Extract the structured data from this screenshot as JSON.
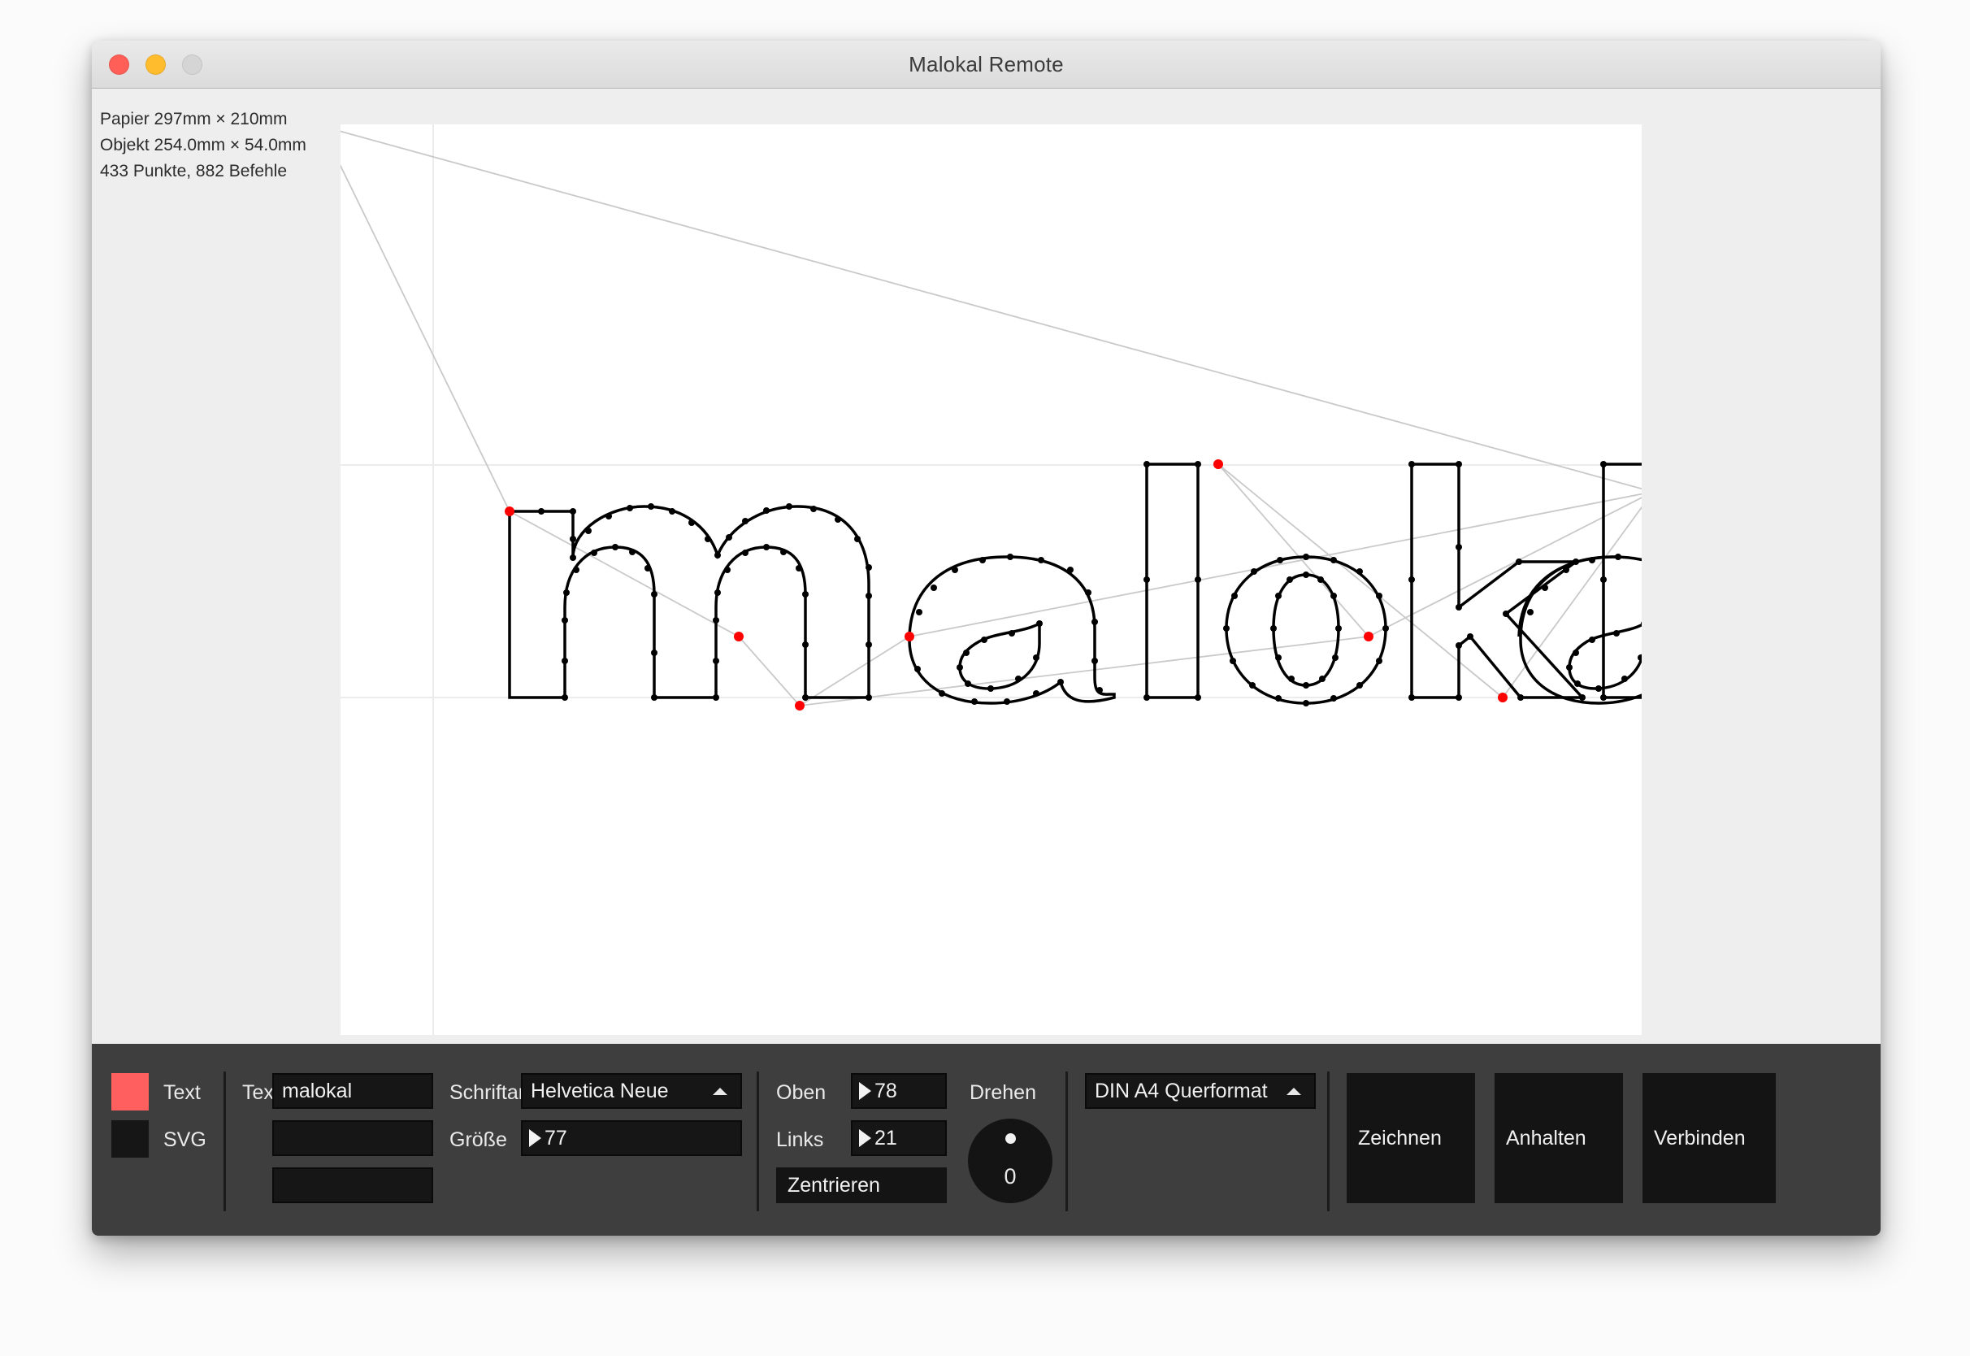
{
  "window": {
    "title": "Malokal Remote",
    "traffic_lights": [
      "close",
      "minimize",
      "zoom"
    ]
  },
  "canvas": {
    "info_lines": [
      "Papier 297mm × 210mm",
      "Objekt 254.0mm × 54.0mm",
      "433 Punkte, 882 Befehle"
    ],
    "paper_label": "Papier 297mm × 210mm",
    "object_label": "Objekt 254.0mm × 54.0mm",
    "points_label": "433 Punkte, 882 Befehle",
    "rendered_word": "malokal",
    "node_color": "#000000",
    "start_node_color": "#ff0000",
    "travel_line_color": "#c8c8c8",
    "guide_line_color": "#ececec",
    "paper_color": "#ffffff"
  },
  "toolbar": {
    "mode": {
      "text_label": "Text",
      "svg_label": "SVG",
      "text_swatch_color": "#ff5f5f",
      "svg_swatch_color": "#161616",
      "active": "Text"
    },
    "text_group": {
      "label": "Text",
      "line1_value": "malokal",
      "line2_value": "",
      "line3_value": ""
    },
    "font_group": {
      "font_label": "Schriftart",
      "font_value": "Helvetica Neue",
      "size_label": "Größe",
      "size_value": "77"
    },
    "position_group": {
      "top_label": "Oben",
      "top_value": "78",
      "left_label": "Links",
      "left_value": "21",
      "center_button": "Zentrieren"
    },
    "rotate_group": {
      "label": "Drehen",
      "value": "0"
    },
    "paper_group": {
      "format_value": "DIN A4 Querformat"
    },
    "actions": {
      "draw": "Zeichnen",
      "stop": "Anhalten",
      "connect": "Verbinden"
    }
  }
}
